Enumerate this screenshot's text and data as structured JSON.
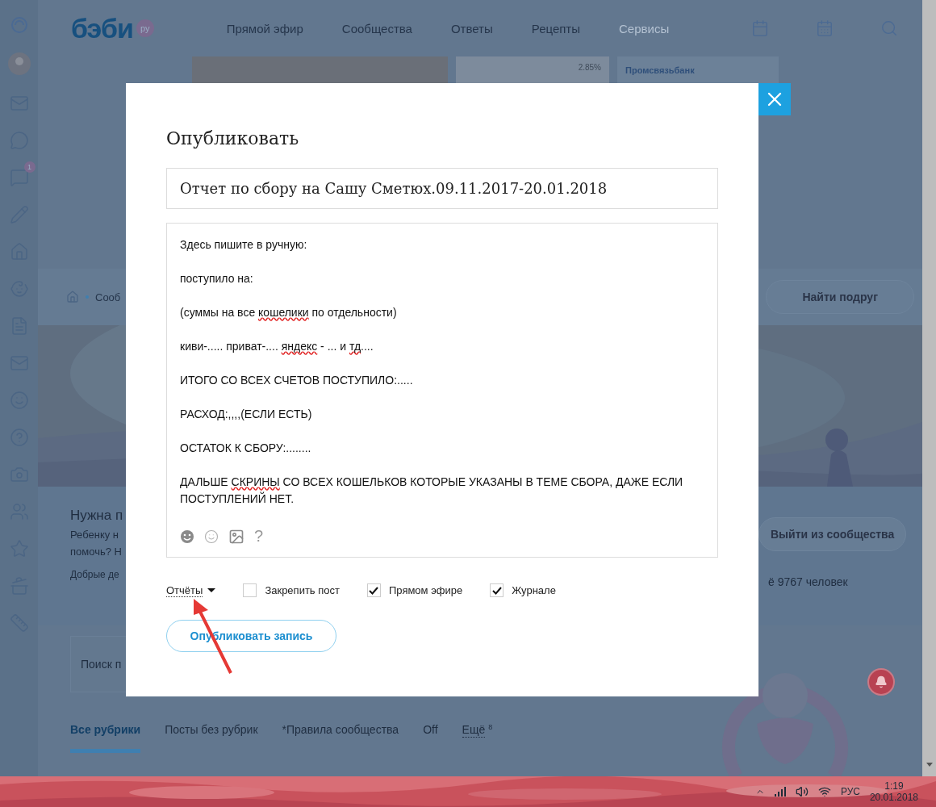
{
  "header": {
    "logo": "бэби",
    "logo_badge": "ру",
    "nav": [
      {
        "label": "Прямой эфир",
        "selected": false
      },
      {
        "label": "Сообщества",
        "selected": false
      },
      {
        "label": "Ответы",
        "selected": false
      },
      {
        "label": "Рецепты",
        "selected": false
      },
      {
        "label": "Сервисы",
        "selected": true
      }
    ]
  },
  "ad": {
    "rate": "2.85%",
    "bank": "Промсвязьбанк"
  },
  "sidebar": {
    "badge": "1"
  },
  "breadcrumb": {
    "item": "Сооб",
    "find_friends": "Найти подруг"
  },
  "community": {
    "title": "Нужна п",
    "lines": [
      "Ребенку н",
      "помочь? Н"
    ],
    "note": "Добрые де",
    "leave_button": "Выйти из сообщества",
    "members": "ё 9767 человек"
  },
  "search": {
    "placeholder": "Поиск п"
  },
  "rubrics": [
    {
      "label": "Все рубрики",
      "selected": true
    },
    {
      "label": "Посты без рубрик",
      "selected": false
    },
    {
      "label": "*Правила сообщества",
      "selected": false
    },
    {
      "label": "Off",
      "selected": false
    }
  ],
  "more": {
    "label": "Ещё",
    "count": "8"
  },
  "modal": {
    "title": "Опубликовать",
    "post_title": "Отчет по сбору на Сашу Сметюх.09.11.2017-20.01.2018",
    "paragraphs": [
      [
        {
          "text": "Здесь пишите в ручную:",
          "misspelled": false
        }
      ],
      [
        {
          "text": "поступило на:",
          "misspelled": false
        }
      ],
      [
        {
          "text": "(суммы на все ",
          "misspelled": false
        },
        {
          "text": "кошелики",
          "misspelled": true
        },
        {
          "text": " по отдельности)",
          "misspelled": false
        }
      ],
      [
        {
          "text": "киви-..... приват-.... ",
          "misspelled": false
        },
        {
          "text": "яндекс",
          "misspelled": true
        },
        {
          "text": " - ... и ",
          "misspelled": false
        },
        {
          "text": "тд",
          "misspelled": true
        },
        {
          "text": "....",
          "misspelled": false
        }
      ],
      [
        {
          "text": "ИТОГО СО ВСЕХ СЧЕТОВ ПОСТУПИЛО:.....",
          "misspelled": false
        }
      ],
      [
        {
          "text": "РАСХОД:,,,,(ЕСЛИ ЕСТЬ)",
          "misspelled": false
        }
      ],
      [
        {
          "text": "ОСТАТОК К СБОРУ:........",
          "misspelled": false
        }
      ],
      [
        {
          "text": "ДАЛЬШЕ ",
          "misspelled": false
        },
        {
          "text": "СКРИНЫ",
          "misspelled": true
        },
        {
          "text": " СО ВСЕХ КОШЕЛЬКОВ КОТОРЫЕ УКАЗАНЫ В ТЕМЕ СБОРА, ДАЖЕ ЕСЛИ ПОСТУПЛЕНИЙ НЕТ.",
          "misspelled": false
        }
      ]
    ],
    "help": "?",
    "rubric": "Отчёты",
    "options": [
      {
        "label": "Закрепить пост",
        "checked": false
      },
      {
        "label": "Прямом эфире",
        "checked": true
      },
      {
        "label": "Журнале",
        "checked": true
      }
    ],
    "submit": "Опубликовать запись"
  },
  "taskbar": {
    "language": "РУС",
    "time": "1:19",
    "date": "20.01.2018"
  }
}
